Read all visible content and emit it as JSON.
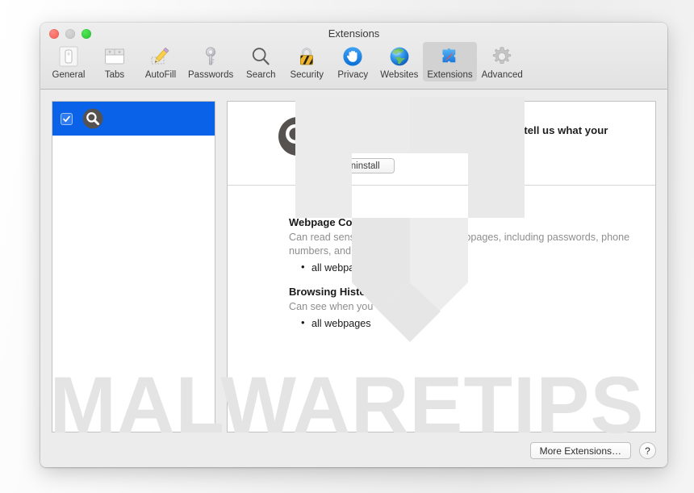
{
  "window": {
    "title": "Extensions",
    "traffic_lights": [
      {
        "name": "close",
        "color": "#f4584f"
      },
      {
        "name": "minimize",
        "color": "#c4c4c4"
      },
      {
        "name": "zoom",
        "color": "#24c32d"
      }
    ]
  },
  "toolbar": {
    "selected": "Extensions",
    "items": [
      {
        "label": "General",
        "icon": "window-icon"
      },
      {
        "label": "Tabs",
        "icon": "tabs-icon"
      },
      {
        "label": "AutoFill",
        "icon": "pencil-icon"
      },
      {
        "label": "Passwords",
        "icon": "key-icon"
      },
      {
        "label": "Search",
        "icon": "magnifier-icon"
      },
      {
        "label": "Security",
        "icon": "padlock-icon"
      },
      {
        "label": "Privacy",
        "icon": "hand-icon"
      },
      {
        "label": "Websites",
        "icon": "globe-icon"
      },
      {
        "label": "Extensions",
        "icon": "puzzle-compass-icon"
      },
      {
        "label": "Advanced",
        "icon": "gear-icon"
      }
    ]
  },
  "sidebar": {
    "extensions": [
      {
        "label": "",
        "checked": true,
        "selected": true,
        "icon": "magnifier-badge-icon"
      }
    ],
    "selection_color": "#0a62e8"
  },
  "detail": {
    "icon": "magnifier-badge-icon",
    "description": "This is a Safari Extension. You should tell us what your extension does here.",
    "uninstall_label": "Uninstall",
    "permissions": [
      {
        "title": "Webpage Contents",
        "description": "Can read sensitive information from webpages, including passwords, phone numbers, and credit cards on:",
        "items": [
          "all webpages"
        ]
      },
      {
        "title": "Browsing History",
        "description": "Can see when you visit:",
        "items": [
          "all webpages"
        ]
      }
    ]
  },
  "footer": {
    "more_extensions_label": "More Extensions…",
    "help_label": "?"
  },
  "watermark": {
    "text": "MALWARETIPS",
    "color": "#e4e4e4"
  }
}
